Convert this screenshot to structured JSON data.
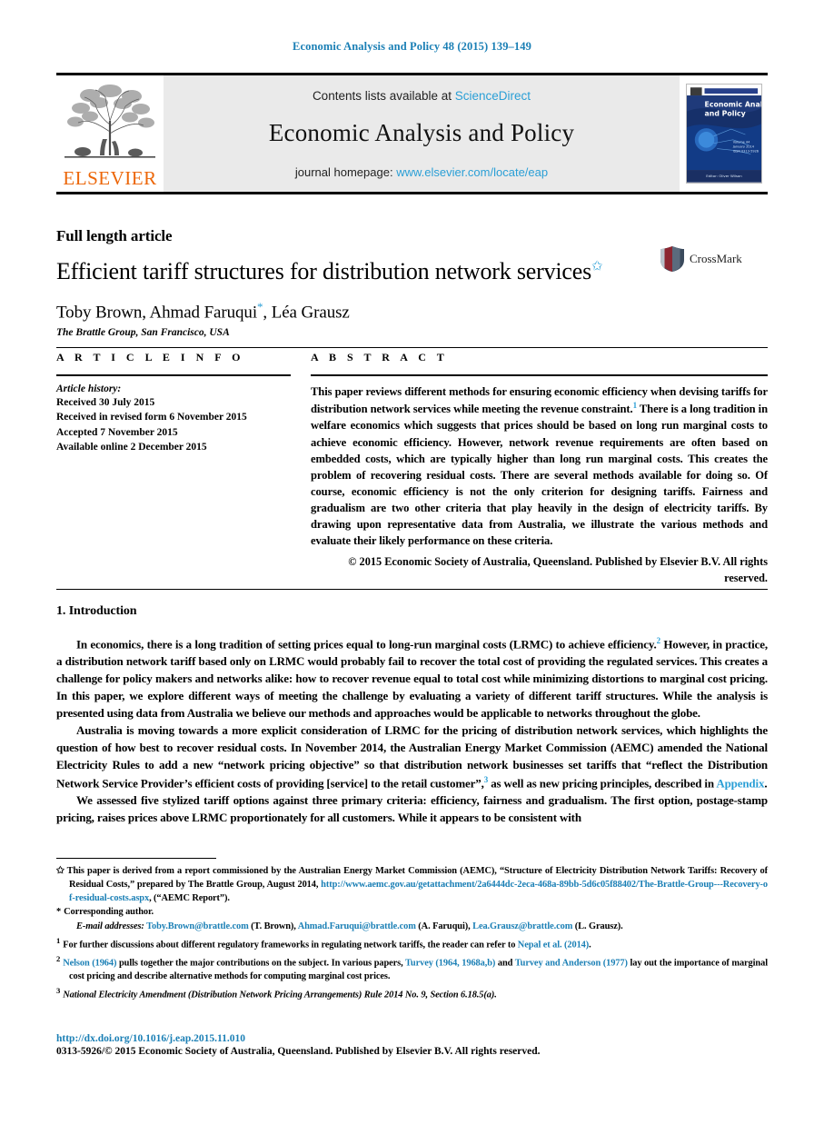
{
  "running_head": "Economic Analysis and Policy 48 (2015) 139–149",
  "masthead": {
    "contents_prefix": "Contents lists available at ",
    "sciencedirect": "ScienceDirect",
    "journal_title": "Economic Analysis and Policy",
    "homepage_prefix": "journal homepage: ",
    "homepage_url": "www.elsevier.com/locate/eap",
    "publisher": "ELSEVIER",
    "cover_title": "Economic Analysis and Policy",
    "cover_editor": "Editor: Oliver Wilson",
    "cover_volume": "Volume 44",
    "cover_date": "January 2014",
    "cover_issn": "ISSN 0313-5926"
  },
  "article": {
    "kicker": "Full length article",
    "title": "Efficient tariff structures for distribution network services",
    "title_star": "✩",
    "authors": "Toby Brown, Ahmad Faruqui",
    "authors_tail": ", Léa Grausz",
    "author_asterisk": "*",
    "affiliation": "The Brattle Group, San Francisco, USA",
    "crossmark_label": "CrossMark"
  },
  "info": {
    "label": "A R T I C L E   I N F O",
    "history_title": "Article history:",
    "history": [
      "Received 30 July 2015",
      "Received in revised form 6 November 2015",
      "Accepted 7 November 2015",
      "Available online 2 December 2015"
    ]
  },
  "abstract": {
    "label": "A B S T R A C T",
    "part1": "This paper reviews different methods for ensuring economic efficiency when devising tariffs for distribution network services while meeting the revenue constraint.",
    "footnote_marker": "1",
    "part2": " There is a long tradition in welfare economics which suggests that prices should be based on long run marginal costs to achieve economic efficiency. However, network revenue requirements are often based on embedded costs, which are typically higher than long run marginal costs. This creates the problem of recovering residual costs. There are several methods available for doing so. Of course, economic efficiency is not the only criterion for designing tariffs. Fairness and gradualism are two other criteria that play heavily in the design of electricity tariffs. By drawing upon representative data from Australia, we illustrate the various methods and evaluate their likely performance on these criteria.",
    "copyright": "© 2015 Economic Society of Australia, Queensland. Published by Elsevier B.V. All rights reserved."
  },
  "body": {
    "section_title": "1. Introduction",
    "p1_a": "In economics, there is a long tradition of setting prices equal to long-run marginal costs (LRMC) to achieve efficiency.",
    "p1_sup": "2",
    "p1_b": " However, in practice, a distribution network tariff based only on LRMC would probably fail to recover the total cost of providing the regulated services. This creates a challenge for policy makers and networks alike: how to recover revenue equal to total cost while minimizing distortions to marginal cost pricing. In this paper, we explore different ways of meeting the challenge by evaluating a variety of different tariff structures. While the analysis is presented using data from Australia we believe our methods and approaches would be applicable to networks throughout the globe.",
    "p2_a": "Australia is moving towards a more explicit consideration of LRMC for the pricing of distribution network services, which highlights the question of how best to recover residual costs. In November 2014, the Australian Energy Market Commission (AEMC) amended the National Electricity Rules to add a new “network pricing objective” so that distribution network businesses set tariffs that “reflect the Distribution Network Service Provider’s efficient costs of providing [service] to the retail customer”,",
    "p2_sup": "3",
    "p2_b": " as well as new pricing principles, described in ",
    "p2_link": "Appendix",
    "p2_c": ".",
    "p3": "We assessed five stylized tariff options against three primary criteria: efficiency, fairness and gradualism. The first option, postage-stamp pricing, raises prices above LRMC proportionately for all customers. While it appears to be consistent with"
  },
  "footnotes": {
    "star_marker": "✩",
    "star_a": "This paper is derived from a report commissioned by the Australian Energy Market Commission (AEMC), “Structure of Electricity Distribution Network Tariffs: Recovery of Residual Costs,” prepared by The Brattle Group, August 2014, ",
    "star_url": "http://www.aemc.gov.au/getattachment/2a6444dc-2eca-468a-89bb-5d6c05f88402/The-Brattle-Group---Recovery-of-residual-costs.aspx",
    "star_b": ", (“AEMC Report”).",
    "corresponding_marker": "*",
    "corresponding": "Corresponding author.",
    "email_label": "E-mail addresses:",
    "emails": [
      {
        "address": "Toby.Brown@brattle.com",
        "who": " (T. Brown), "
      },
      {
        "address": "Ahmad.Faruqui@brattle.com",
        "who": " (A. Faruqui), "
      },
      {
        "address": "Lea.Grausz@brattle.com",
        "who": " (L. Grausz)."
      }
    ],
    "fn1_marker": "1",
    "fn1_a": "For further discussions about different regulatory frameworks in regulating network tariffs, the reader can refer to ",
    "fn1_link": "Nepal et al. (2014)",
    "fn1_b": ".",
    "fn2_marker": "2",
    "fn2_link1": "Nelson (1964)",
    "fn2_a": " pulls together the major contributions on the subject. In various papers, ",
    "fn2_link2": "Turvey (1964, 1968a,b)",
    "fn2_b": " and ",
    "fn2_link3": "Turvey and Anderson (1977)",
    "fn2_c": " lay out the importance of marginal cost pricing and describe alternative methods for computing marginal cost prices.",
    "fn3_marker": "3",
    "fn3": "National Electricity Amendment (Distribution Network Pricing Arrangements) Rule 2014 No. 9, Section 6.18.5(a)."
  },
  "footer": {
    "doi": "http://dx.doi.org/10.1016/j.eap.2015.11.010",
    "issn_line": "0313-5926/© 2015 Economic Society of Australia, Queensland. Published by Elsevier B.V. All rights reserved."
  },
  "colors": {
    "link": "#2a9fd6",
    "running_head": "#1a7fb5",
    "elsevier_orange": "#ec6608",
    "panel_grey": "#eaeaea"
  }
}
